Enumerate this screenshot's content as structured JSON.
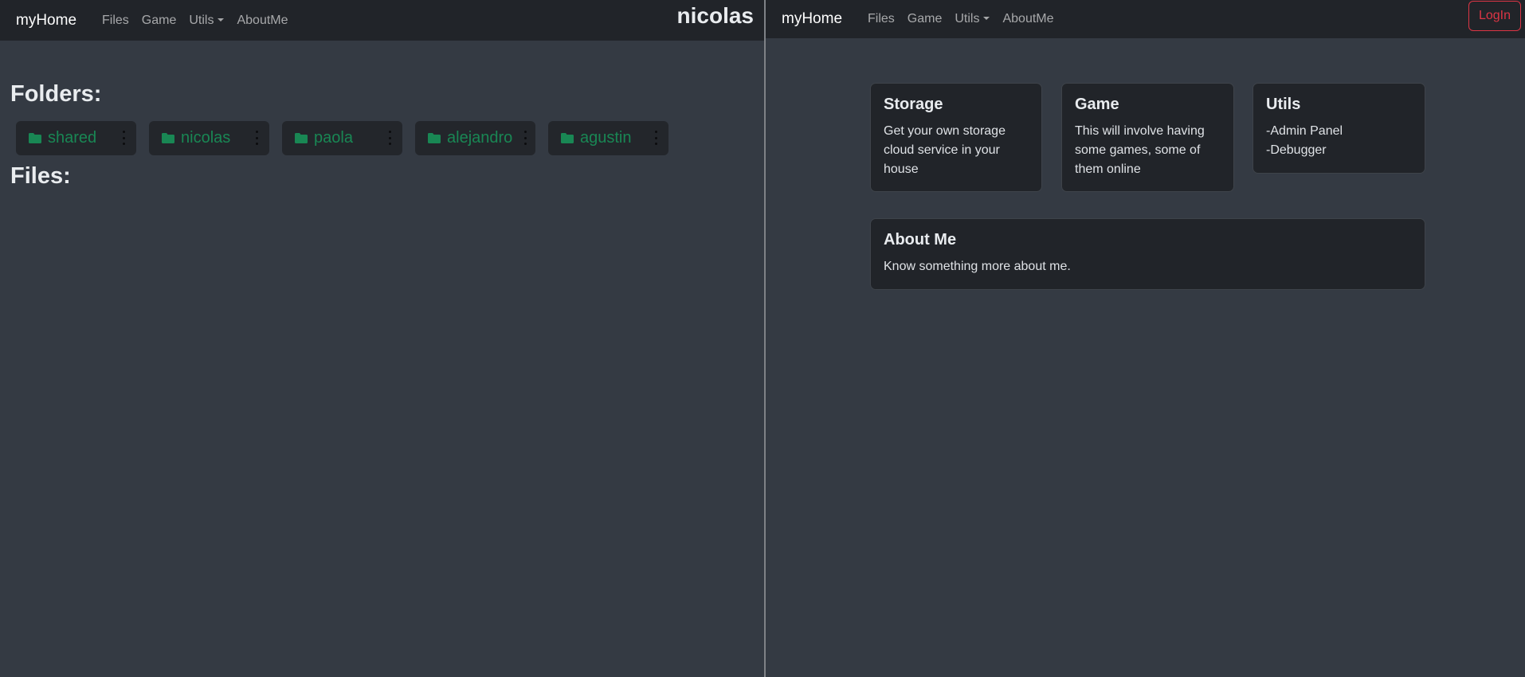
{
  "left": {
    "brand": "myHome",
    "nav": [
      {
        "label": "Files"
      },
      {
        "label": "Game"
      },
      {
        "label": "Utils"
      },
      {
        "label": "AboutMe"
      }
    ],
    "username": "nicolas",
    "folders_heading": "Folders:",
    "files_heading": "Files:",
    "folders": [
      {
        "name": "shared"
      },
      {
        "name": "nicolas"
      },
      {
        "name": "paola"
      },
      {
        "name": "alejandro"
      },
      {
        "name": "agustin"
      }
    ],
    "folder_color": "#198754"
  },
  "right": {
    "brand": "myHome",
    "nav": [
      {
        "label": "Files"
      },
      {
        "label": "Game"
      },
      {
        "label": "Utils"
      },
      {
        "label": "AboutMe"
      }
    ],
    "login_label": "LogIn",
    "login_color": "#dc3545",
    "cards": {
      "storage": {
        "title": "Storage",
        "lines": [
          "Get your own storage",
          "cloud service in your",
          "house"
        ]
      },
      "game": {
        "title": "Game",
        "lines": [
          "This will involve having",
          "some games, some of",
          "them online"
        ]
      },
      "utils": {
        "title": "Utils",
        "lines": [
          "-Admin Panel",
          "-Debugger"
        ]
      },
      "about": {
        "title": "About Me",
        "lines": [
          "Know something more about me."
        ]
      }
    }
  }
}
